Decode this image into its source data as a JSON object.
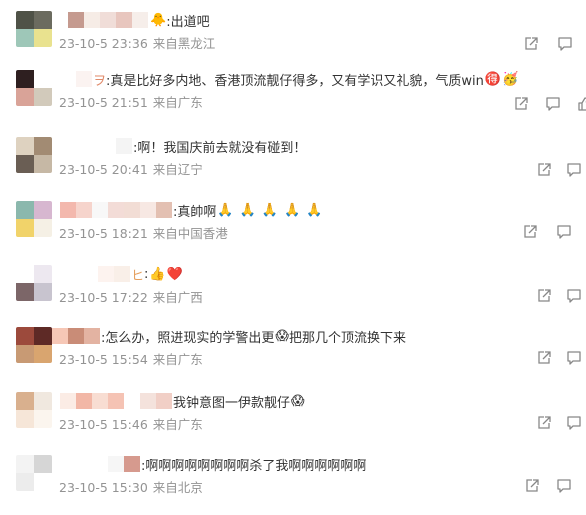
{
  "icons": {
    "reply": "share-icon",
    "comment": "comment-icon",
    "like": "like-icon"
  },
  "comments": [
    {
      "prefix": "",
      "text": ":出道吧",
      "emojis": [
        "🐥"
      ],
      "emojis_after": "",
      "time": "23-10-5 23:36",
      "location": "来自黑龙江"
    },
    {
      "prefix": "ヲ",
      "text": ":真是比好多内地、香港顶流靓仔得多，又有学识又礼貌，气质win",
      "emojis": [
        "🉐",
        "🥳"
      ],
      "emojis_after": "",
      "time": "23-10-5 21:51",
      "location": "来自广东"
    },
    {
      "prefix": "",
      "text": ":啊！我国庆前去就没有碰到！",
      "emojis": [],
      "emojis_after": "",
      "time": "23-10-5 20:41",
      "location": "来自辽宁"
    },
    {
      "prefix": "",
      "text": ":真帥啊",
      "emojis": [
        "🙏",
        "🙏",
        "🙏",
        "🙏",
        "🙏"
      ],
      "emojis_after": "",
      "time": "23-10-5 18:21",
      "location": "来自中国香港"
    },
    {
      "prefix": "ヒ",
      "text": ":",
      "emojis": [
        "👍",
        "❤️"
      ],
      "emojis_after": "",
      "time": "23-10-5 17:22",
      "location": "来自广西"
    },
    {
      "prefix": "",
      "text": ":怎么办，照进现实的学警出更",
      "emojis": [
        "😱"
      ],
      "emojis_after": "把那几个顶流换下来",
      "time": "23-10-5 15:54",
      "location": "来自广东"
    },
    {
      "prefix": "",
      "text": "我钟意图一伊款靓仔",
      "emojis": [
        "😱"
      ],
      "emojis_after": "",
      "time": "23-10-5 15:46",
      "location": "来自广东"
    },
    {
      "prefix": "",
      "text": ":啊啊啊啊啊啊啊啊杀了我啊啊啊啊啊啊",
      "emojis": [],
      "emojis_after": "",
      "time": "23-10-5 15:30",
      "location": "来自北京"
    }
  ]
}
